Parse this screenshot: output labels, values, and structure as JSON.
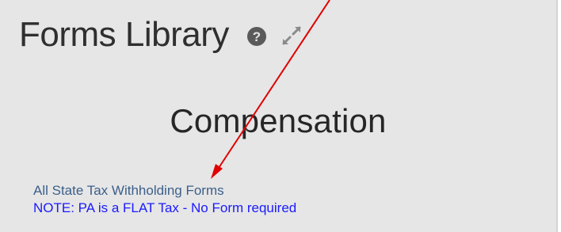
{
  "page": {
    "title": "Forms Library",
    "section_title": "Compensation"
  },
  "icons": {
    "help": "help-circle-icon",
    "expand": "expand-icon"
  },
  "links": {
    "state_tax_forms": "All State Tax Withholding Forms",
    "note": "NOTE:  PA is a FLAT Tax - No Form required"
  },
  "colors": {
    "panel_bg": "#e6e6e6",
    "link": "#3b5f8a",
    "note": "#1a1aff",
    "arrow": "#e00000"
  }
}
